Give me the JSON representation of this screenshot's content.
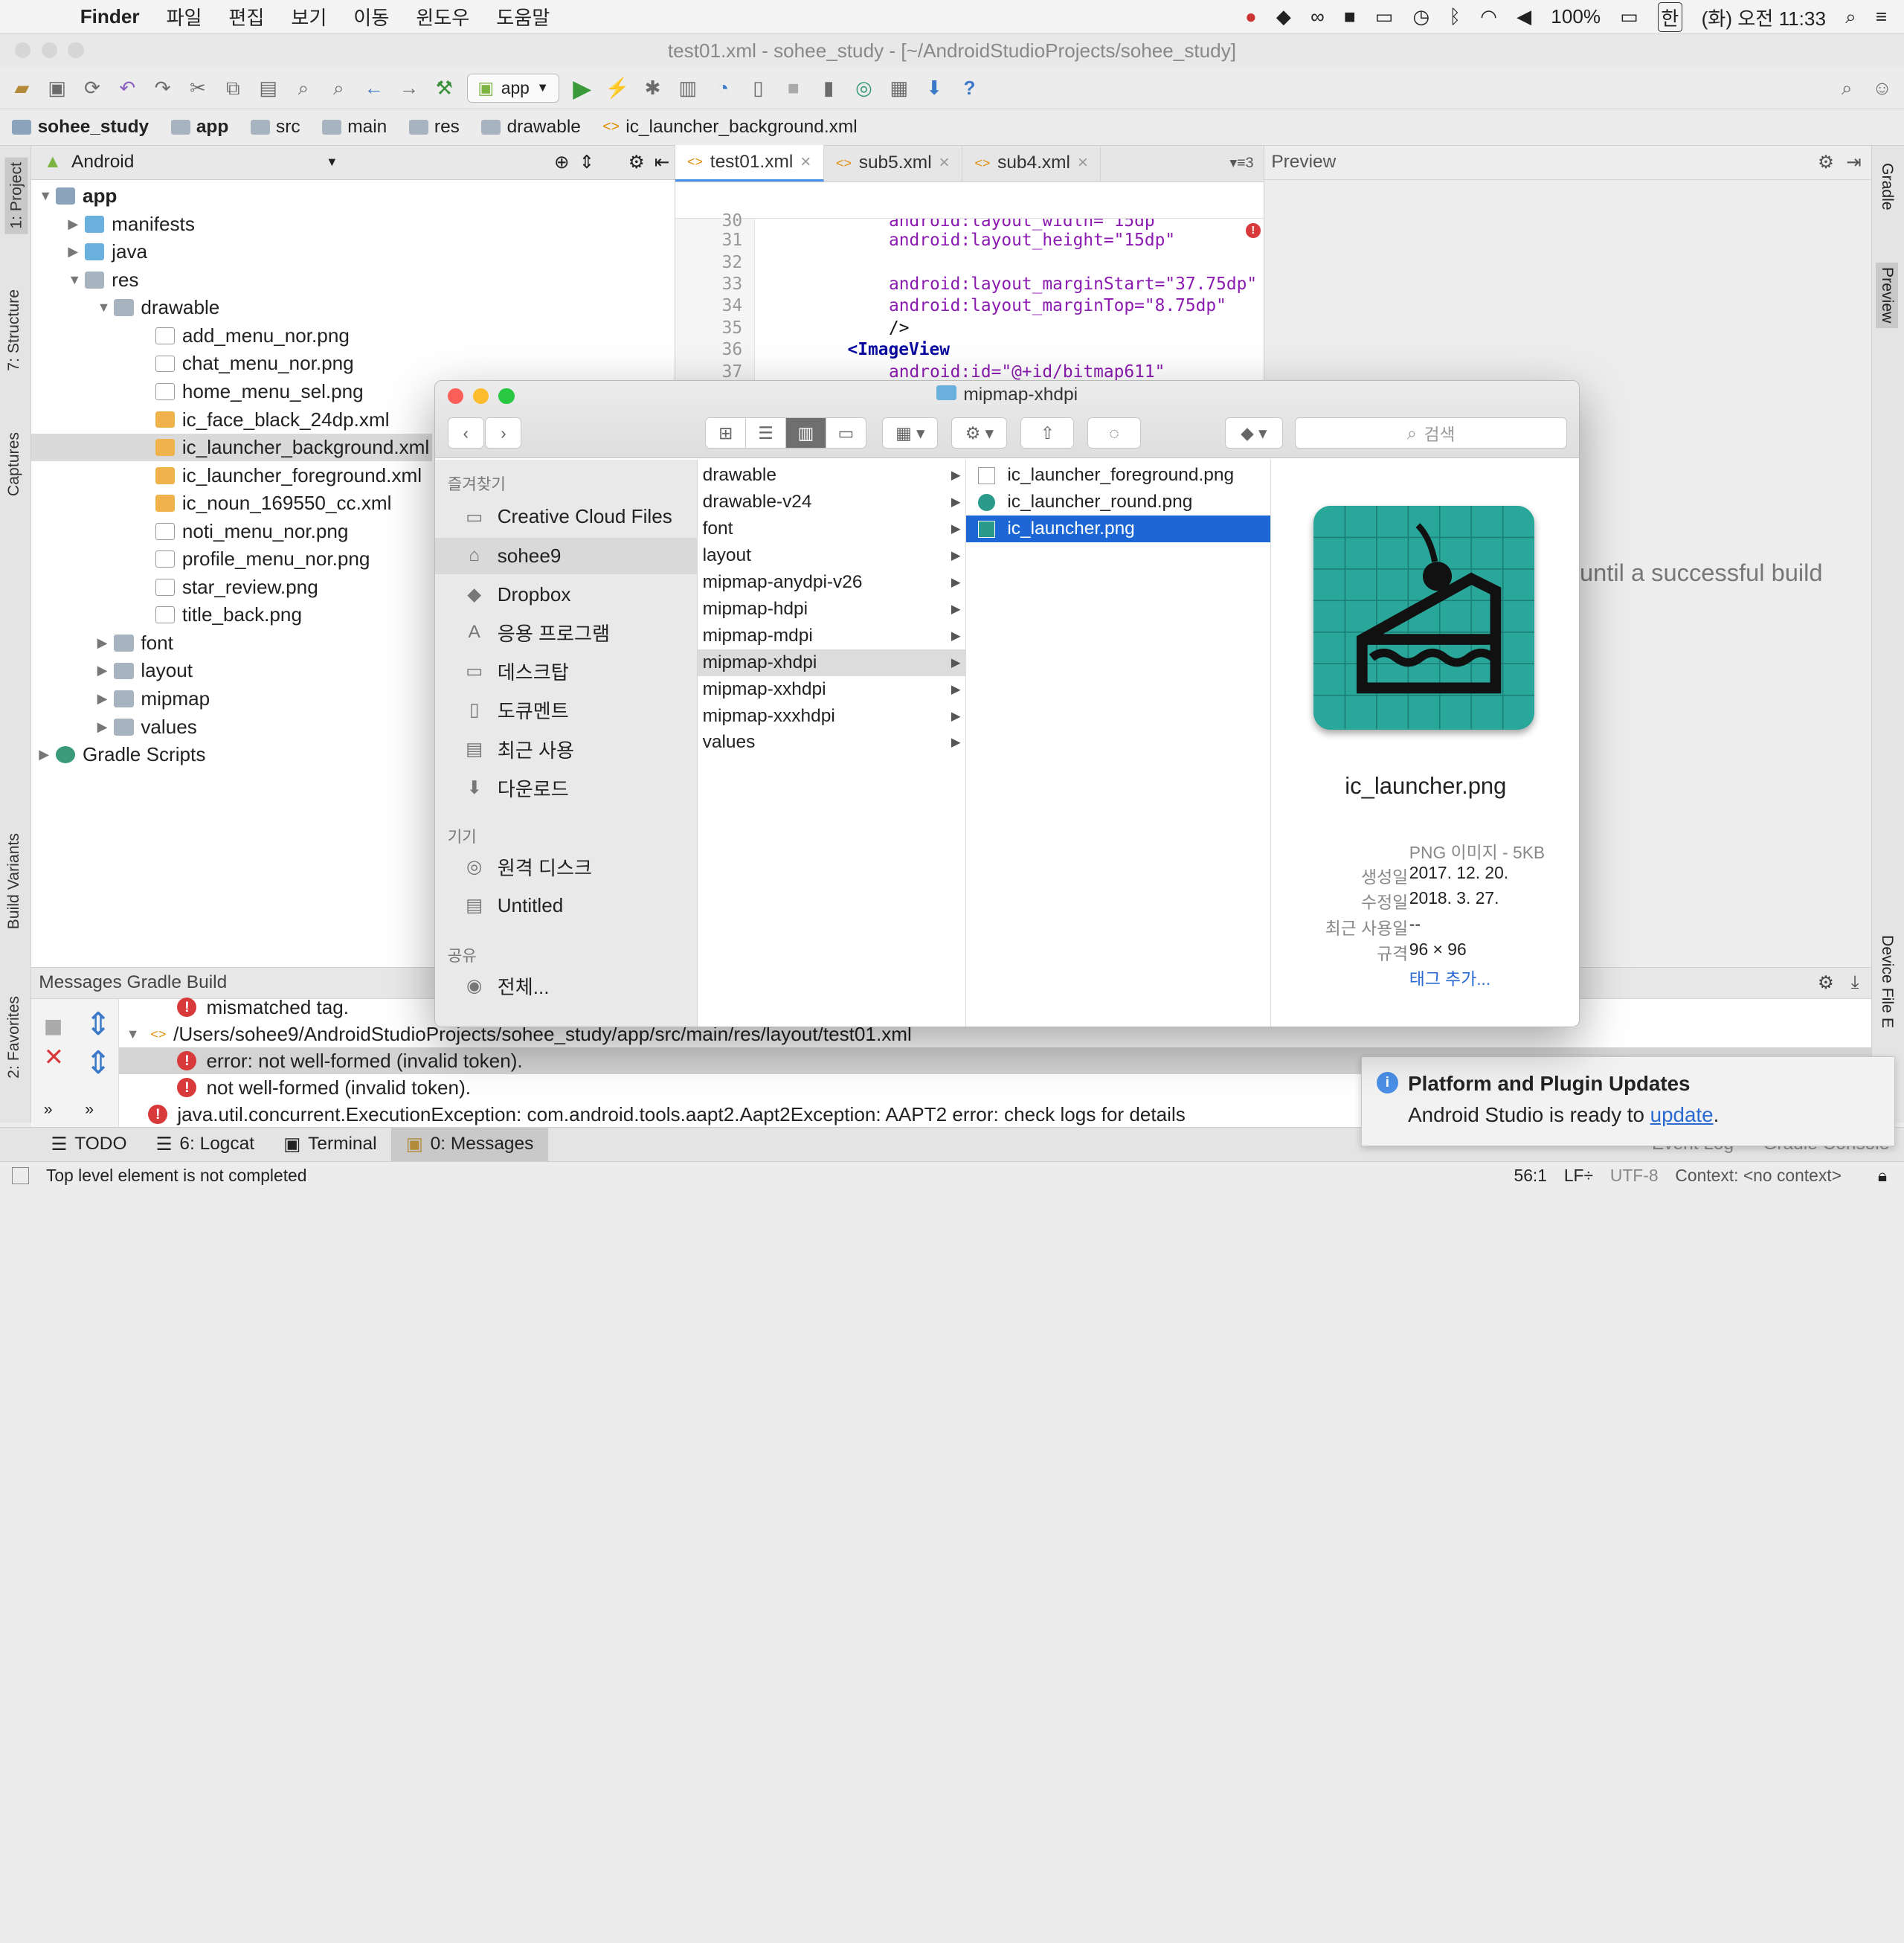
{
  "menubar": {
    "app": "Finder",
    "items": [
      "파일",
      "편집",
      "보기",
      "이동",
      "윈도우",
      "도움말"
    ],
    "battery": "100%",
    "input_lang": "한",
    "clock": "(화) 오전 11:33"
  },
  "window_title": "test01.xml - sohee_study - [~/AndroidStudioProjects/sohee_study]",
  "toolbar": {
    "run_config": "app"
  },
  "breadcrumb": [
    "sohee_study",
    "app",
    "src",
    "main",
    "res",
    "drawable",
    "ic_launcher_background.xml"
  ],
  "left_tabs": {
    "project": "1: Project",
    "structure": "7: Structure",
    "captures": "Captures",
    "build_variants": "Build Variants",
    "favorites": "2: Favorites"
  },
  "right_tabs": {
    "gradle": "Gradle",
    "preview": "Preview",
    "device": "Device File E"
  },
  "project": {
    "view": "Android",
    "tree": [
      "app",
      "manifests",
      "java",
      "res",
      "drawable",
      "add_menu_nor.png",
      "chat_menu_nor.png",
      "home_menu_sel.png",
      "ic_face_black_24dp.xml",
      "ic_launcher_background.xml",
      "ic_launcher_foreground.xml",
      "ic_noun_169550_cc.xml",
      "noti_menu_nor.png",
      "profile_menu_nor.png",
      "star_review.png",
      "title_back.png",
      "font",
      "layout",
      "mipmap",
      "values",
      "Gradle Scripts"
    ]
  },
  "editor": {
    "tabs": [
      "test01.xml",
      "sub5.xml",
      "sub4.xml"
    ],
    "tab_count": "3",
    "lines": [
      {
        "n": "30",
        "text": "android:layout_width=\"15dp\""
      },
      {
        "n": "31",
        "text": "android:layout_height=\"15dp\""
      },
      {
        "n": "32",
        "text": ""
      },
      {
        "n": "33",
        "text": "android:layout_marginStart=\"37.75dp\""
      },
      {
        "n": "34",
        "text": "android:layout_marginTop=\"8.75dp\""
      },
      {
        "n": "35",
        "text": "/>"
      },
      {
        "n": "36",
        "text": "<ImageView"
      },
      {
        "n": "37",
        "text": "android:id=\"@+id/bitmap611\""
      }
    ]
  },
  "preview": {
    "title": "Preview",
    "message": "until a successful build"
  },
  "finder": {
    "title": "mipmap-xhdpi",
    "search_placeholder": "검색",
    "favorites_header": "즐겨찾기",
    "favorites": [
      "Creative Cloud Files",
      "sohee9",
      "Dropbox",
      "응용 프로그램",
      "데스크탑",
      "도큐멘트",
      "최근 사용",
      "다운로드"
    ],
    "devices_header": "기기",
    "devices": [
      "원격 디스크",
      "Untitled"
    ],
    "shared_header": "공유",
    "shared": [
      "전체..."
    ],
    "column1": [
      "drawable",
      "drawable-v24",
      "font",
      "layout",
      "mipmap-anydpi-v26",
      "mipmap-hdpi",
      "mipmap-mdpi",
      "mipmap-xhdpi",
      "mipmap-xxhdpi",
      "mipmap-xxxhdpi",
      "values"
    ],
    "column2": [
      "ic_launcher_foreground.png",
      "ic_launcher_round.png",
      "ic_launcher.png"
    ],
    "preview_name": "ic_launcher.png",
    "kind": "PNG 이미지 - 5KB",
    "meta": [
      {
        "k": "생성일",
        "v": "2017. 12. 20."
      },
      {
        "k": "수정일",
        "v": "2018. 3. 27."
      },
      {
        "k": "최근 사용일",
        "v": "--"
      },
      {
        "k": "규격",
        "v": "96 × 96"
      }
    ],
    "add_tag": "태그 추가..."
  },
  "messages": {
    "header": "Messages Gradle Build",
    "rows": [
      "mismatched tag.",
      "/Users/sohee9/AndroidStudioProjects/sohee_study/app/src/main/res/layout/test01.xml",
      "error: not well-formed (invalid token).",
      "not well-formed (invalid token).",
      "java.util.concurrent.ExecutionException: com.android.tools.aapt2.Aapt2Exception: AAPT2 error: check logs for details"
    ]
  },
  "bottom_tabs": [
    "TODO",
    "6: Logcat",
    "Terminal",
    "0: Messages",
    "Event Log",
    "Gradle Console"
  ],
  "notice": {
    "title": "Platform and Plugin Updates",
    "text": "Android Studio is ready to",
    "link": "update"
  },
  "status": {
    "message": "Top level element is not completed",
    "position": "56:1",
    "lf": "LF÷",
    "encoding": "UTF-8",
    "context": "Context: <no context>"
  }
}
